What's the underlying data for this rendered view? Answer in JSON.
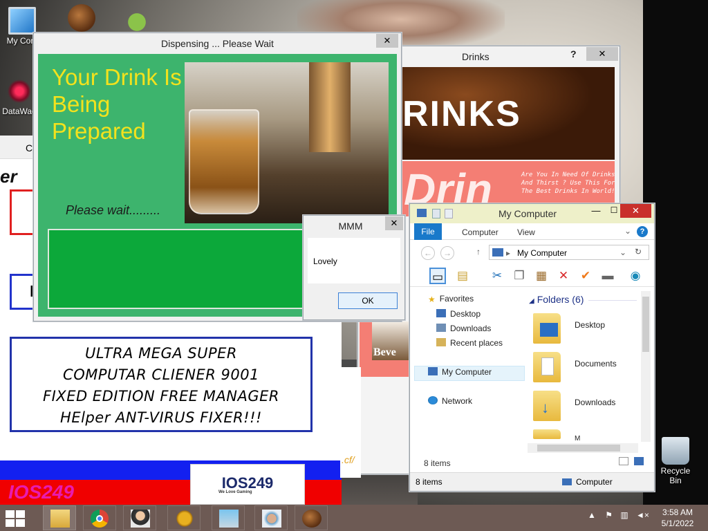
{
  "desktop": {
    "icons": [
      {
        "label": "My Com",
        "icon": "computer-icon"
      },
      {
        "label": "",
        "icon": "coffee-bean-icon"
      },
      {
        "label": "",
        "icon": "android-icon"
      },
      {
        "label": "DataWag",
        "icon": "datawag-icon"
      },
      {
        "label": "Recycle Bin",
        "icon": "recycle-bin-icon"
      }
    ]
  },
  "cleaner": {
    "strip_text": "C",
    "partial_heading": "er",
    "partial_box_letter": "l",
    "mega_lines": [
      "ULTRA MEGA SUPER",
      "COMPUTAR CLIENER 9001",
      "FIXED EDITION FREE MANAGER",
      "HElper ANT-VIRUS FIXER!!!"
    ],
    "brand_text": "IOS249",
    "logo_text": "IOS249",
    "logo_tagline": "We Love Gaming"
  },
  "drinks": {
    "title": "Drinks",
    "help": "?",
    "close": "✕",
    "banner_word": "RINKS",
    "pink_big": "Drin",
    "pink_small": "Are You In Need Of Drinks And Thirst ? Use This For The Best Drinks In World!",
    "thumb_text": "Beve",
    "link_fragment": ".cf/"
  },
  "dispensing": {
    "title": "Dispensing ... Please Wait",
    "close": "✕",
    "heading": "Your Drink Is Being Prepared",
    "wait_text": "Please wait........."
  },
  "mmm": {
    "title": "MMM",
    "close": "✕",
    "message": "Lovely",
    "ok": "OK"
  },
  "explorer": {
    "title": "My Computer",
    "minimize": "—",
    "maximize": "☐",
    "close": "✕",
    "ribbon": {
      "file": "File",
      "tabs": [
        "Computer",
        "View"
      ],
      "help": "?"
    },
    "address": "My Computer",
    "nav": {
      "favorites": "Favorites",
      "items": [
        "Desktop",
        "Downloads",
        "Recent places"
      ],
      "my_computer": "My Computer",
      "network": "Network"
    },
    "folders_header": "Folders (6)",
    "folders": [
      "Desktop",
      "Documents",
      "Downloads",
      "M"
    ],
    "status_inner": "8 items",
    "status_left": "8 items",
    "status_right": "Computer"
  },
  "taskbar": {
    "apps": [
      "file-explorer-icon",
      "chrome-icon",
      "person-icon",
      "settings-icon",
      "skype-icon",
      "avatar-icon",
      "coffee-bean-icon"
    ],
    "tray_arrow": "▲",
    "time": "3:58 AM",
    "date": "5/1/2022"
  }
}
